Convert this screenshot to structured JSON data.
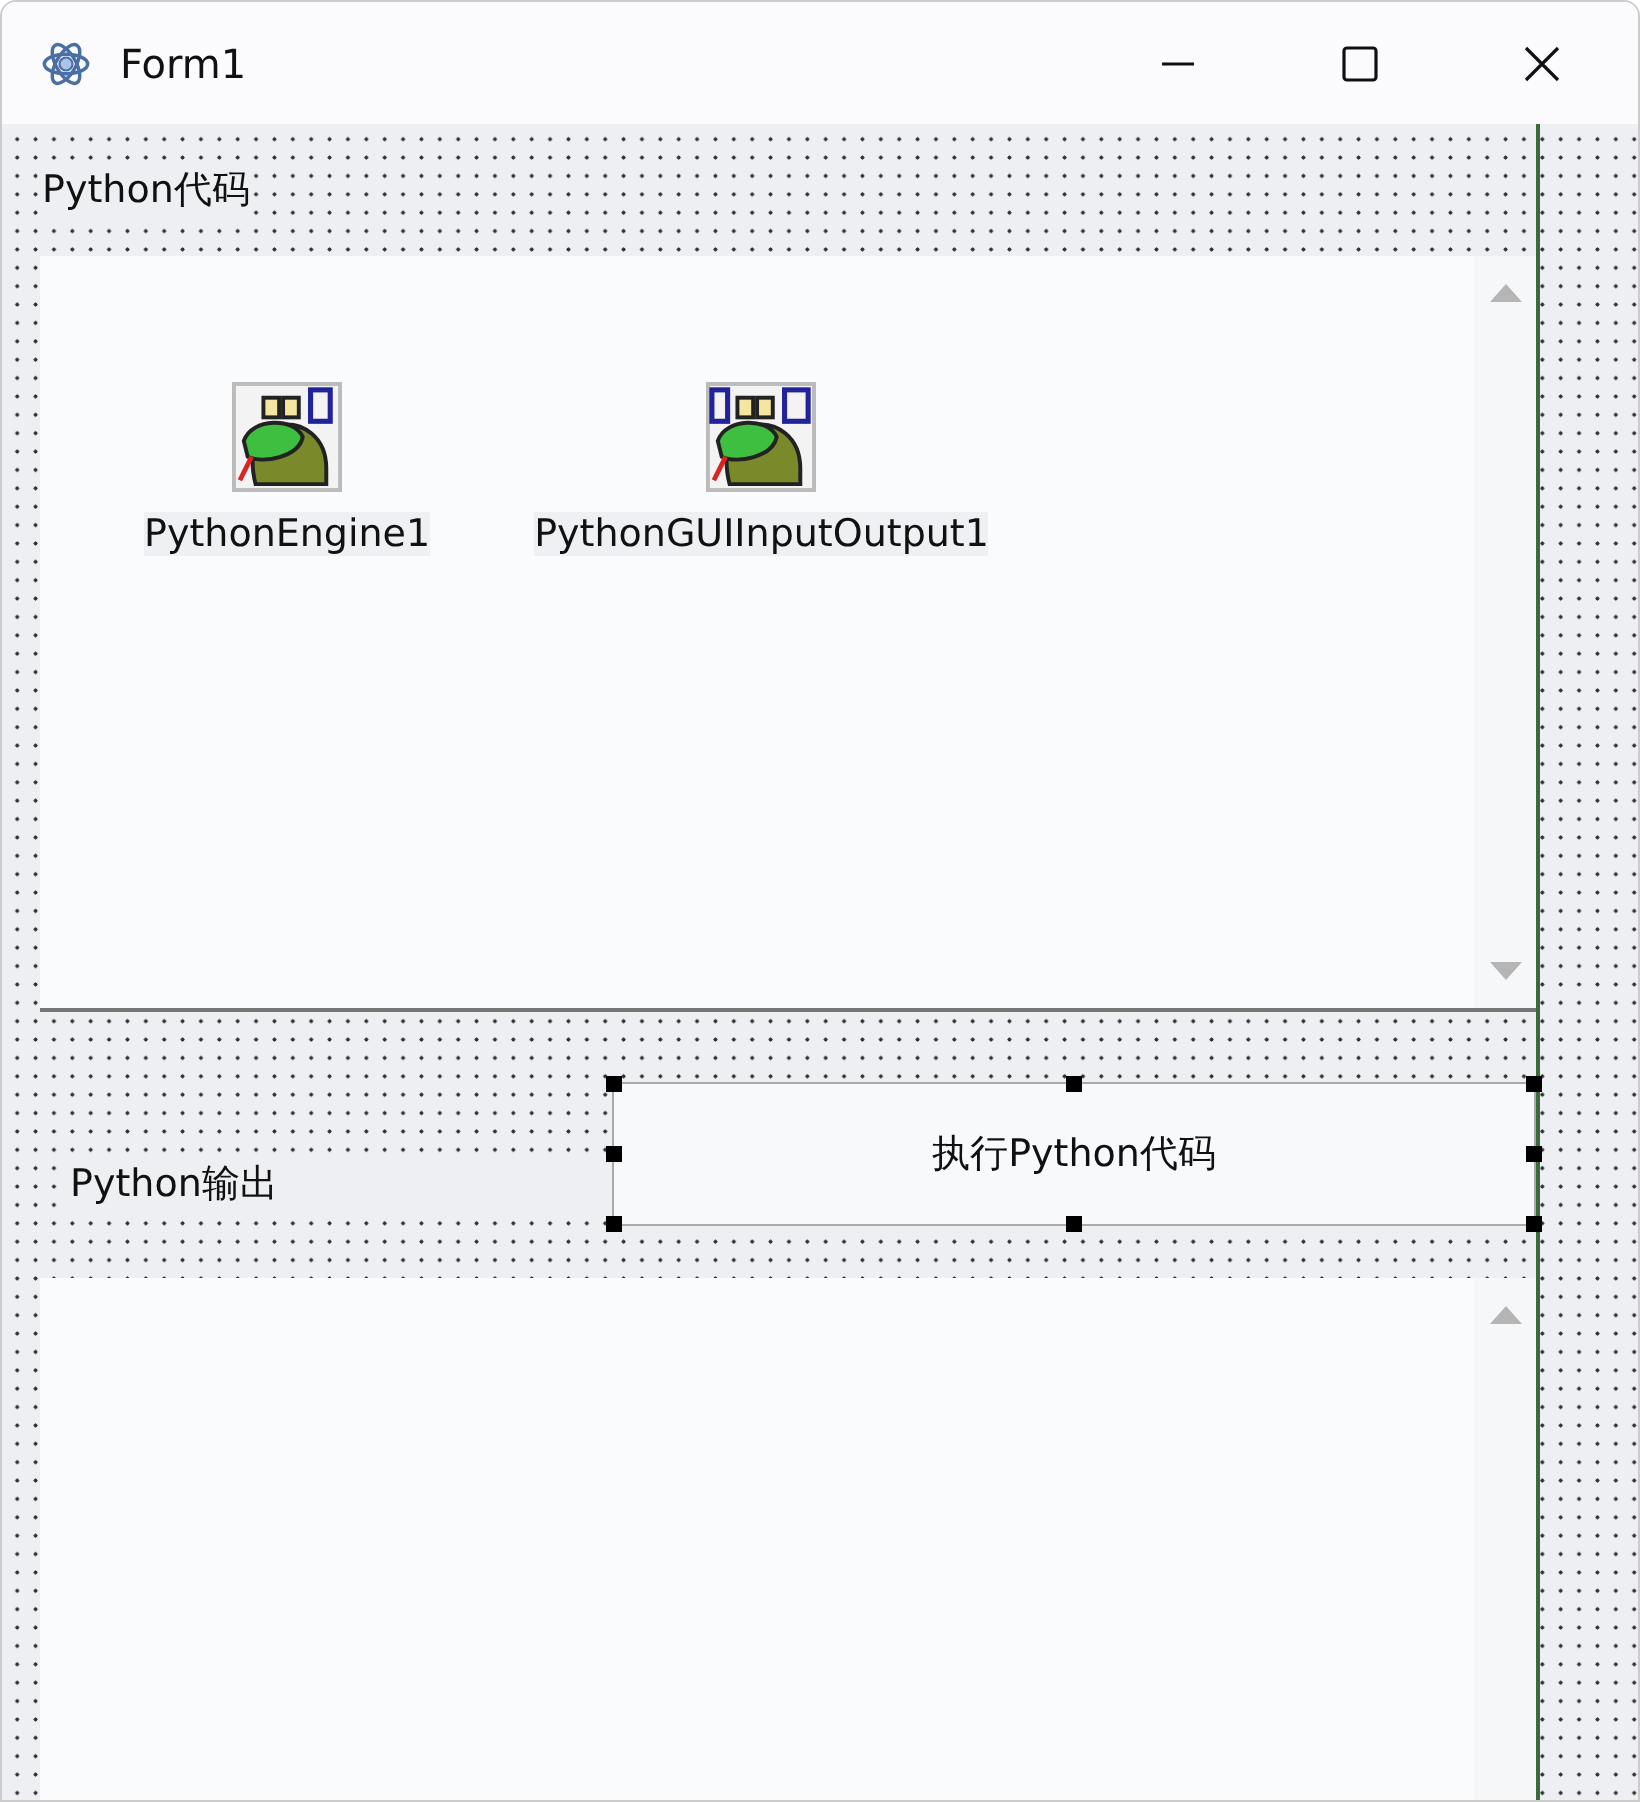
{
  "window": {
    "title": "Form1"
  },
  "code_label": "Python代码",
  "components": [
    {
      "name": "PythonEngine1",
      "kind": "engine"
    },
    {
      "name": "PythonGUIInputOutput1",
      "kind": "gui_io"
    }
  ],
  "output_label": "Python输出",
  "run_button": {
    "label": "执行Python代码",
    "selected": true
  }
}
